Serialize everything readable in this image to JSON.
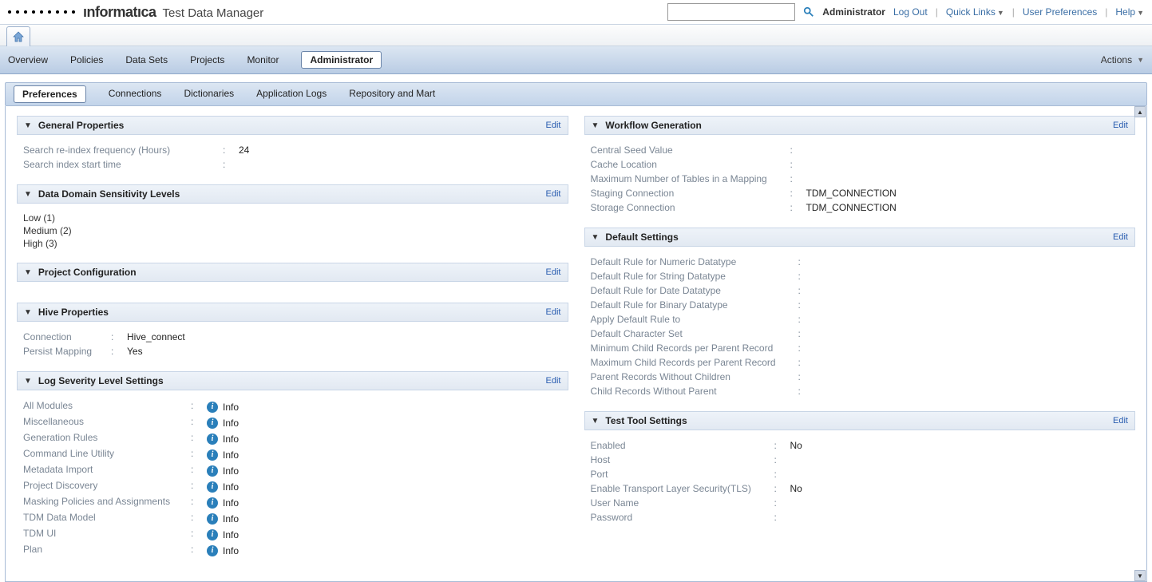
{
  "app": {
    "title": "Test Data Manager"
  },
  "topnav": {
    "admin": "Administrator",
    "logout": "Log Out",
    "quicklinks": "Quick Links",
    "userprefs": "User Preferences",
    "help": "Help"
  },
  "tabs": {
    "overview": "Overview",
    "policies": "Policies",
    "datasets": "Data Sets",
    "projects": "Projects",
    "monitor": "Monitor",
    "administrator": "Administrator",
    "actions": "Actions"
  },
  "subtabs": {
    "preferences": "Preferences",
    "connections": "Connections",
    "dictionaries": "Dictionaries",
    "applogs": "Application Logs",
    "repo": "Repository and Mart"
  },
  "common": {
    "edit": "Edit",
    "info": "Info"
  },
  "general": {
    "title": "General Properties",
    "reindex_label": "Search re-index frequency (Hours)",
    "reindex_value": "24",
    "starttime_label": "Search index start time",
    "starttime_value": ""
  },
  "sensitivity": {
    "title": "Data Domain Sensitivity Levels",
    "levels": [
      "Low (1)",
      "Medium (2)",
      "High (3)"
    ]
  },
  "projectconf": {
    "title": "Project Configuration"
  },
  "hive": {
    "title": "Hive Properties",
    "connection_label": "Connection",
    "connection_value": "Hive_connect",
    "persist_label": "Persist Mapping",
    "persist_value": "Yes"
  },
  "log": {
    "title": "Log Severity Level Settings",
    "rows": [
      {
        "label": "All Modules",
        "value": "Info"
      },
      {
        "label": "Miscellaneous",
        "value": "Info"
      },
      {
        "label": "Generation Rules",
        "value": "Info"
      },
      {
        "label": "Command Line Utility",
        "value": "Info"
      },
      {
        "label": "Metadata Import",
        "value": "Info"
      },
      {
        "label": "Project Discovery",
        "value": "Info"
      },
      {
        "label": "Masking Policies and Assignments",
        "value": "Info"
      },
      {
        "label": "TDM Data Model",
        "value": "Info"
      },
      {
        "label": "TDM UI",
        "value": "Info"
      },
      {
        "label": "Plan",
        "value": "Info"
      }
    ]
  },
  "workflow": {
    "title": "Workflow Generation",
    "rows": [
      {
        "label": "Central Seed Value",
        "value": ""
      },
      {
        "label": "Cache Location",
        "value": ""
      },
      {
        "label": "Maximum Number of Tables in a Mapping",
        "value": ""
      },
      {
        "label": "Staging Connection",
        "value": "TDM_CONNECTION"
      },
      {
        "label": "Storage Connection",
        "value": "TDM_CONNECTION"
      }
    ]
  },
  "defaults": {
    "title": "Default Settings",
    "rows": [
      {
        "label": "Default Rule for Numeric Datatype",
        "value": ""
      },
      {
        "label": "Default Rule for String Datatype",
        "value": ""
      },
      {
        "label": "Default Rule for Date Datatype",
        "value": ""
      },
      {
        "label": "Default Rule for Binary Datatype",
        "value": ""
      },
      {
        "label": "Apply Default Rule to",
        "value": ""
      },
      {
        "label": "Default Character Set",
        "value": ""
      },
      {
        "label": "Minimum Child Records per Parent Record",
        "value": ""
      },
      {
        "label": "Maximum Child Records per Parent Record",
        "value": ""
      },
      {
        "label": "Parent Records Without Children",
        "value": ""
      },
      {
        "label": "Child Records Without Parent",
        "value": ""
      }
    ]
  },
  "testtool": {
    "title": "Test Tool Settings",
    "rows": [
      {
        "label": "Enabled",
        "value": "No"
      },
      {
        "label": "Host",
        "value": ""
      },
      {
        "label": "Port",
        "value": ""
      },
      {
        "label": "Enable Transport Layer Security(TLS)",
        "value": "No"
      },
      {
        "label": "User Name",
        "value": ""
      },
      {
        "label": "Password",
        "value": ""
      }
    ]
  }
}
